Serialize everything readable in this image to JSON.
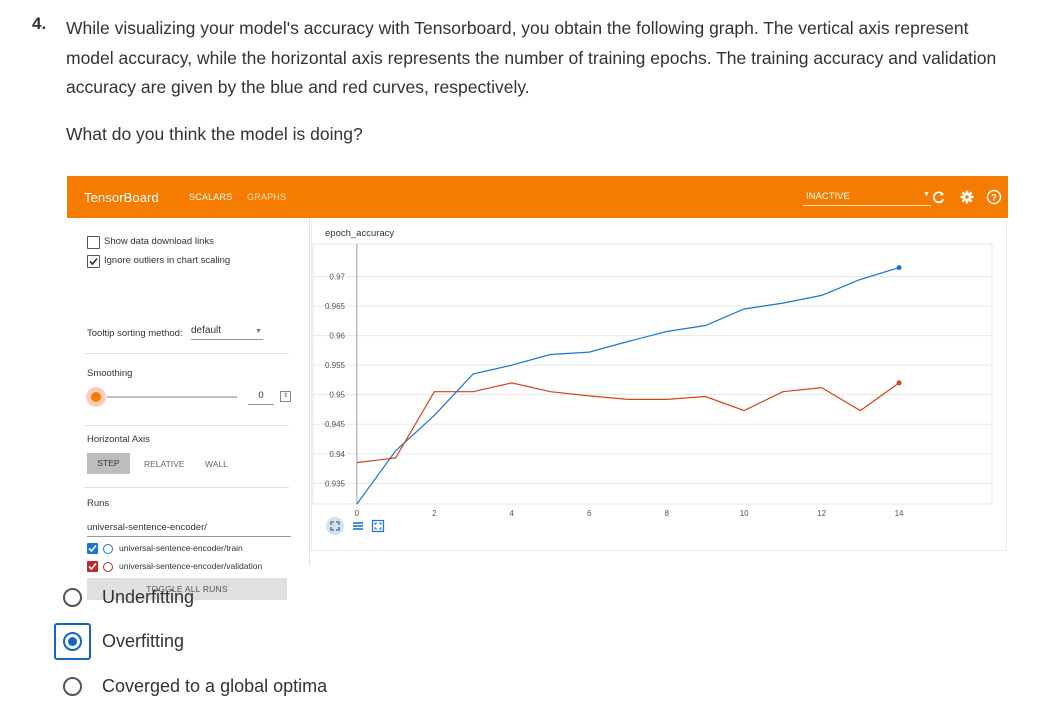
{
  "question": {
    "number": "4.",
    "text": "While visualizing your model's accuracy with Tensorboard, you obtain the following graph. The vertical axis represent model accuracy, while the horizontal axis represents the number of training epochs. The training accuracy and validation accuracy are given by the blue and red curves, respectively.",
    "ask": "What do you think the model is doing?"
  },
  "tensorboard": {
    "brand": "TensorBoard",
    "tabs": [
      "SCALARS",
      "GRAPHS"
    ],
    "status_select": "INACTIVE",
    "header_icons": [
      "refresh-icon",
      "settings-icon",
      "help-icon"
    ],
    "accent": "#f57c00",
    "sidebar": {
      "show_download": "Show data download links",
      "ignore_outliers": "Ignore outliers in chart scaling",
      "show_download_checked": false,
      "ignore_outliers_checked": true,
      "tooltip_label": "Tooltip sorting method:",
      "tooltip_value": "default",
      "smoothing_label": "Smoothing",
      "smoothing_value": "0",
      "horizontal_axis_label": "Horizontal Axis",
      "axis_buttons": [
        "STEP",
        "RELATIVE",
        "WALL"
      ],
      "runs_label": "Runs",
      "runs_filter": "universal-sentence-encoder/",
      "runs": [
        {
          "name": "universal-sentence-encoder/train",
          "color": "#1976d2",
          "checked": true
        },
        {
          "name": "universal-sentence-encoder/validation",
          "color": "#c62828",
          "checked": true
        }
      ],
      "toggle_all": "TOGGLE ALL RUNS"
    },
    "chart_title": "epoch_accuracy"
  },
  "chart_data": {
    "type": "line",
    "title": "epoch_accuracy",
    "xlabel": "",
    "ylabel": "",
    "xlim": [
      -0.1,
      16.4
    ],
    "ylim": [
      0.9315,
      0.9755
    ],
    "x_ticks": [
      "0",
      "2",
      "4",
      "6",
      "8",
      "10",
      "12",
      "14"
    ],
    "y_ticks": [
      "0.935",
      "0.94",
      "0.945",
      "0.95",
      "0.955",
      "0.96",
      "0.965",
      "0.97"
    ],
    "grid": true,
    "series": [
      {
        "name": "universal-sentence-encoder/train",
        "color": "#1976d2",
        "x": [
          0,
          1,
          2,
          3,
          4,
          5,
          6,
          7,
          8,
          9,
          10,
          11,
          12,
          13,
          14
        ],
        "y": [
          0.9315,
          0.9405,
          0.9465,
          0.9535,
          0.955,
          0.9568,
          0.9572,
          0.959,
          0.9607,
          0.9617,
          0.9645,
          0.9655,
          0.9668,
          0.9695,
          0.9715
        ]
      },
      {
        "name": "universal-sentence-encoder/validation",
        "color": "#d84315",
        "x": [
          0,
          1,
          2,
          3,
          4,
          5,
          6,
          7,
          8,
          9,
          10,
          11,
          12,
          13,
          14
        ],
        "y": [
          0.9385,
          0.9393,
          0.9505,
          0.9505,
          0.952,
          0.9505,
          0.9498,
          0.9492,
          0.9492,
          0.9497,
          0.9473,
          0.9505,
          0.9512,
          0.9473,
          0.952
        ]
      }
    ]
  },
  "options": [
    {
      "label": "Underfitting",
      "selected": false
    },
    {
      "label": "Overfitting",
      "selected": true
    },
    {
      "label": "Coverged to a global optima",
      "selected": false
    }
  ]
}
